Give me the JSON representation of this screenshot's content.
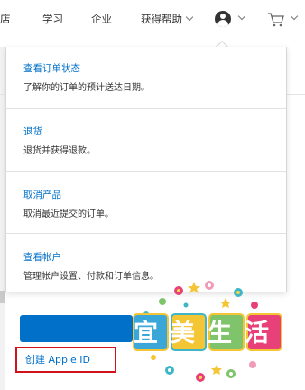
{
  "nav": {
    "items": [
      {
        "label": "店"
      },
      {
        "label": "学习"
      },
      {
        "label": "企业"
      },
      {
        "label": "获得帮助"
      }
    ],
    "account_icon": "user-circle-icon",
    "cart_icon": "shopping-bag-icon"
  },
  "dropdown": {
    "items": [
      {
        "title": "查看订单状态",
        "desc": "了解你的订单的预计送达日期。"
      },
      {
        "title": "退货",
        "desc": "退货并获得退款。"
      },
      {
        "title": "取消产品",
        "desc": "取消最近提交的订单。"
      },
      {
        "title": "查看帐户",
        "desc": "管理帐户设置、付款和订单信息。"
      }
    ]
  },
  "signin": {
    "create_apple_id": "创建 Apple ID"
  },
  "watermark": {
    "text": "宜美生活"
  },
  "colors": {
    "link": "#0070c9",
    "button": "#0070c9",
    "highlight_box": "#d0121b"
  }
}
